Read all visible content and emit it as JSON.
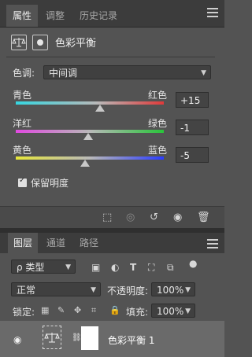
{
  "props_panel": {
    "tabs": [
      "属性",
      "调整",
      "历史记录"
    ],
    "title": "色彩平衡",
    "tone_label": "色调:",
    "tone_value": "中间调",
    "sliders": [
      {
        "left_label": "青色",
        "right_label": "红色",
        "value": "+15"
      },
      {
        "left_label": "洋红",
        "right_label": "绿色",
        "value": "-1"
      },
      {
        "left_label": "黄色",
        "right_label": "蓝色",
        "value": "-5"
      }
    ],
    "preserve_luminosity": "保留明度"
  },
  "layers_panel": {
    "tabs": [
      "图层",
      "通道",
      "路径"
    ],
    "filter_label": "ρ 类型",
    "blend_mode": "正常",
    "opacity_label": "不透明度:",
    "opacity_value": "100%",
    "lock_label": "锁定:",
    "fill_label": "填充:",
    "fill_value": "100%",
    "layer": {
      "name": "色彩平衡 1"
    }
  },
  "colors": {
    "cyan": "#36d6e0",
    "red": "#e03a3a",
    "magenta": "#e04ae0",
    "green": "#29c43a",
    "yellow": "#e6e63a",
    "blue": "#2b3cff"
  }
}
